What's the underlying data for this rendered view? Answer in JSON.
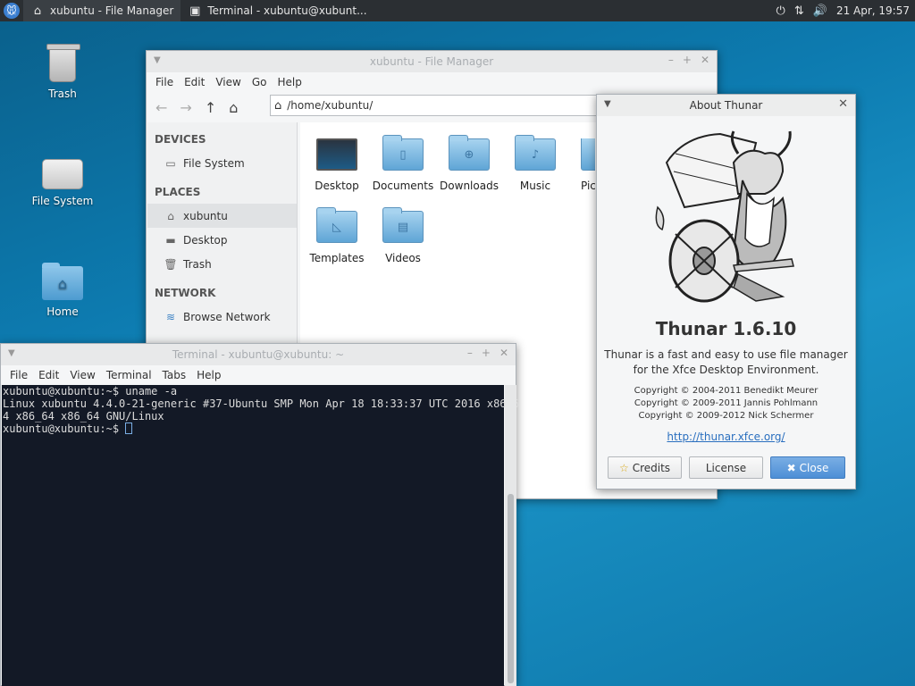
{
  "panel": {
    "tasks": [
      {
        "label": "xubuntu - File Manager",
        "icon": "home-icon"
      },
      {
        "label": "Terminal - xubuntu@xubunt...",
        "icon": "terminal-icon"
      }
    ],
    "clock": "21 Apr, 19:57"
  },
  "desktop": {
    "icons": [
      {
        "label": "Trash"
      },
      {
        "label": "File System"
      },
      {
        "label": "Home"
      }
    ]
  },
  "file_manager": {
    "title": "xubuntu - File Manager",
    "menu": [
      "File",
      "Edit",
      "View",
      "Go",
      "Help"
    ],
    "location": "/home/xubuntu/",
    "sidebar": {
      "devices_header": "DEVICES",
      "devices": [
        "File System"
      ],
      "places_header": "PLACES",
      "places": [
        "xubuntu",
        "Desktop",
        "Trash"
      ],
      "network_header": "NETWORK",
      "network": [
        "Browse Network"
      ]
    },
    "items": [
      "Desktop",
      "Documents",
      "Downloads",
      "Music",
      "Pic",
      "Templates",
      "Videos"
    ]
  },
  "about": {
    "title": "About Thunar",
    "app_name": "Thunar 1.6.10",
    "description_line1": "Thunar is a fast and easy to use file manager",
    "description_line2": "for the Xfce Desktop Environment.",
    "copyright_lines": [
      "Copyright © 2004-2011 Benedikt Meurer",
      "Copyright © 2009-2011 Jannis Pohlmann",
      "Copyright © 2009-2012 Nick Schermer"
    ],
    "link": "http://thunar.xfce.org/",
    "buttons": {
      "credits": "Credits",
      "license": "License",
      "close": "Close"
    }
  },
  "terminal": {
    "title": "Terminal - xubuntu@xubuntu: ~",
    "menu": [
      "File",
      "Edit",
      "View",
      "Terminal",
      "Tabs",
      "Help"
    ],
    "lines": [
      "xubuntu@xubuntu:~$ uname -a",
      "Linux xubuntu 4.4.0-21-generic #37-Ubuntu SMP Mon Apr 18 18:33:37 UTC 2016 x86_6",
      "4 x86_64 x86_64 GNU/Linux"
    ],
    "prompt": "xubuntu@xubuntu:~$ "
  }
}
